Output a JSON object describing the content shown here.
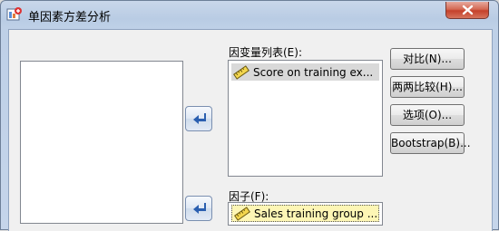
{
  "window": {
    "title": "单因素方差分析",
    "icon": "spss-dialog-icon",
    "close_icon": "close-icon"
  },
  "source_list": {
    "items": []
  },
  "dependent_list": {
    "label": "因变量列表(E):",
    "items": [
      {
        "icon": "scale-ruler-icon",
        "label": "Score on training ex..."
      }
    ]
  },
  "factor": {
    "label": "因子(F):",
    "value": {
      "icon": "scale-ruler-icon",
      "label": "Sales training group ..."
    }
  },
  "buttons": {
    "contrasts": "对比(N)...",
    "post_hoc": "两两比较(H)...",
    "options": "选项(O)...",
    "bootstrap": "Bootstrap(B)..."
  },
  "move_buttons": {
    "dependent_icon": "left-arrow-icon",
    "factor_icon": "left-arrow-icon"
  },
  "colors": {
    "title_bar": "#bed0e7",
    "close_button": "#c5412b",
    "dialog_bg": "#f0f0f0",
    "selected_item": "#d9d9d9",
    "factor_item": "#fdf6b5",
    "arrow": "#2a5fb0"
  }
}
